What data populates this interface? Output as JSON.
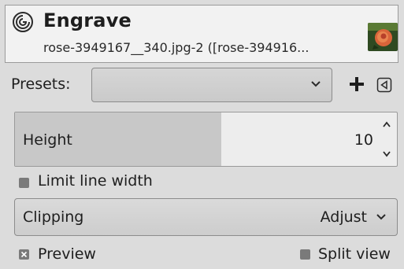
{
  "header": {
    "title": "Engrave",
    "subtitle": "rose-3949167__340.jpg-2 ([rose-394916...",
    "icon": "gegl-swirl-icon",
    "thumbnail": "rose-thumbnail"
  },
  "presets": {
    "label": "Presets:",
    "value": "",
    "add_icon": "plus-icon",
    "menu_icon": "menu-triangle-icon"
  },
  "height": {
    "label": "Height",
    "value": "10",
    "fill_fraction": 0.54
  },
  "limit_line_width": {
    "label": "Limit line width",
    "checked": false
  },
  "clipping": {
    "label": "Clipping",
    "value": "Adjust"
  },
  "preview": {
    "label": "Preview",
    "checked": true
  },
  "split_view": {
    "label": "Split view",
    "checked": false
  },
  "colors": {
    "background": "#dcdcdc",
    "header_bg": "#f2f2f2",
    "text": "#1e1e1e",
    "spin_fill": "#c8c8c8"
  }
}
